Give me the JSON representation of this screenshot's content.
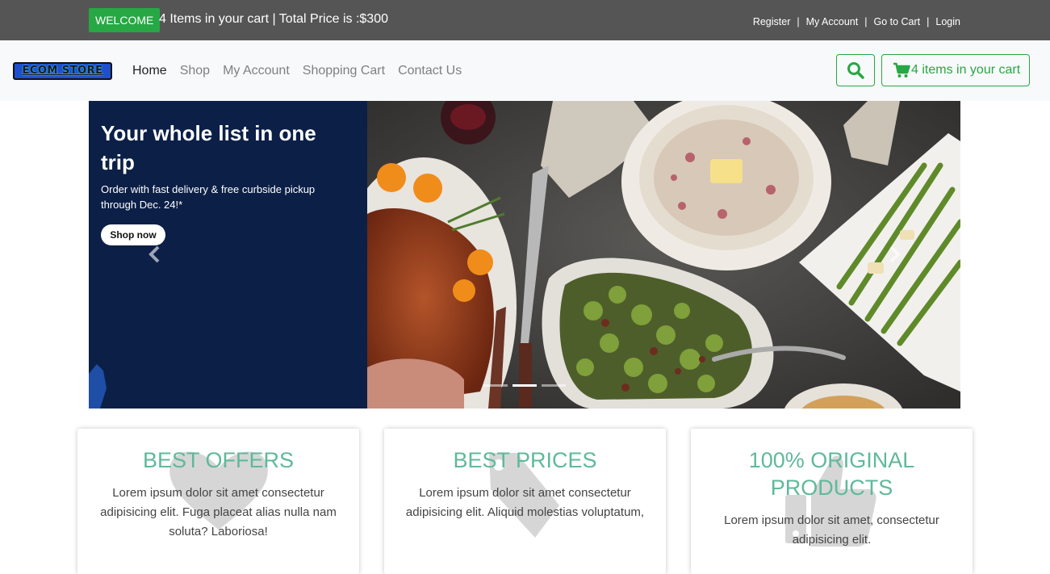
{
  "topbar": {
    "welcome_badge": "WELCOME",
    "cart_summary": "4 Items in your cart | Total Price is :$300",
    "links": [
      "Register",
      "My Account",
      "Go to Cart",
      "Login"
    ],
    "separator": "|"
  },
  "navbar": {
    "logo_text": "ECOM STORE",
    "links": [
      "Home",
      "Shop",
      "My Account",
      "Shopping Cart",
      "Contact Us"
    ],
    "active_link": "Home",
    "search_icon": "search-icon",
    "cart_button_label": "4 items in your cart",
    "cart_icon": "shopping-cart-icon"
  },
  "carousel": {
    "title": "Your whole list in one trip",
    "subtitle": "Order with fast delivery & free curbside pickup through Dec. 24!*",
    "cta_label": "Shop now",
    "slide_count": 3,
    "active_slide": 2,
    "prev_icon": "chevron-left-icon",
    "next_icon": "chevron-right-icon"
  },
  "features": [
    {
      "title": "BEST OFFERS",
      "text": "Lorem ipsum dolor sit amet consectetur adipisicing elit. Fuga placeat alias nulla nam soluta? Laboriosa!",
      "icon": "heart-icon"
    },
    {
      "title": "BEST PRICES",
      "text": "Lorem ipsum dolor sit amet consectetur adipisicing elit. Aliquid molestias voluptatum,",
      "icon": "tag-icon"
    },
    {
      "title": "100% ORIGINAL PRODUCTS",
      "text": "Lorem ipsum dolor sit amet, consectetur adipisicing elit.",
      "icon": "thumbs-up-icon"
    }
  ],
  "colors": {
    "topbar_bg": "#555555",
    "accent_green": "#28a745",
    "navbar_bg": "#f8f9fa",
    "slide_panel_bg": "#0b1f47",
    "feature_title": "#5fb99a"
  }
}
